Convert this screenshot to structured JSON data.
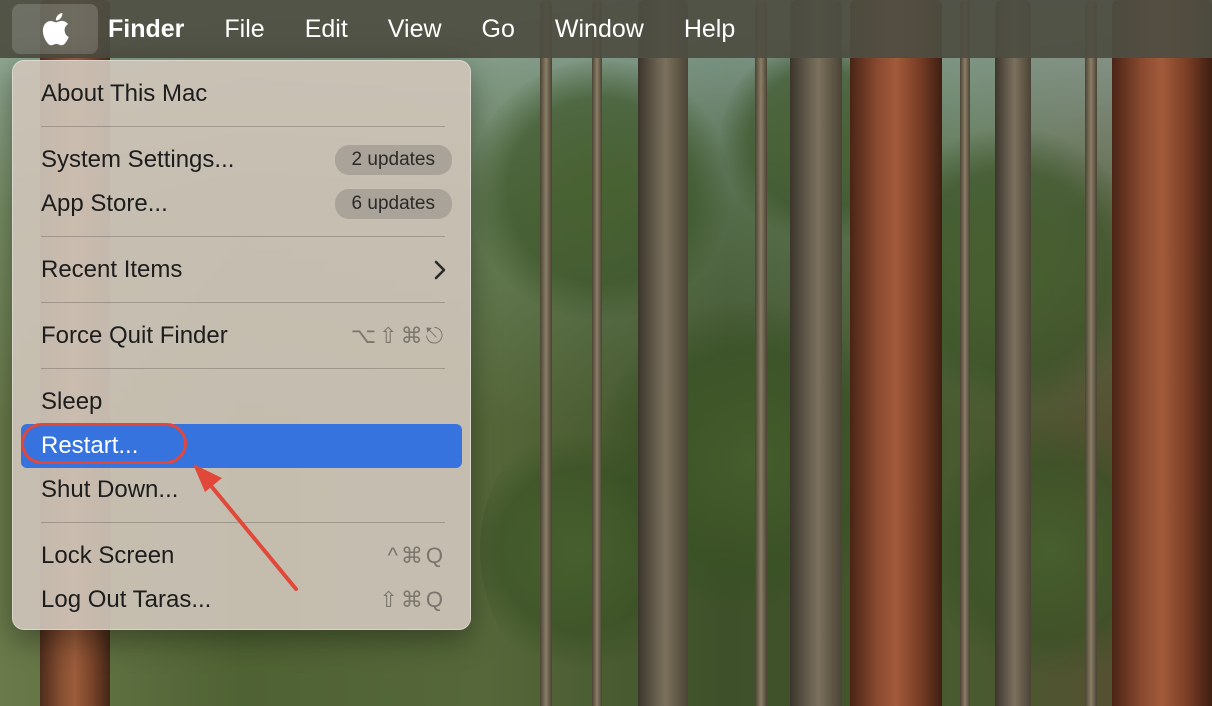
{
  "menubar": {
    "apple_icon": "apple-logo-icon",
    "items": [
      {
        "label": "Finder"
      },
      {
        "label": "File"
      },
      {
        "label": "Edit"
      },
      {
        "label": "View"
      },
      {
        "label": "Go"
      },
      {
        "label": "Window"
      },
      {
        "label": "Help"
      }
    ]
  },
  "apple_menu": {
    "about": {
      "label": "About This Mac"
    },
    "system_settings": {
      "label": "System Settings...",
      "badge": "2 updates"
    },
    "app_store": {
      "label": "App Store...",
      "badge": "6 updates"
    },
    "recent_items": {
      "label": "Recent Items",
      "submenu_icon": "chevron-right-icon"
    },
    "force_quit": {
      "label": "Force Quit Finder",
      "shortcut": "⌥⇧⌘⎋"
    },
    "sleep": {
      "label": "Sleep"
    },
    "restart": {
      "label": "Restart..."
    },
    "shut_down": {
      "label": "Shut Down..."
    },
    "lock_screen": {
      "label": "Lock Screen",
      "shortcut": "^⌘Q"
    },
    "log_out": {
      "label": "Log Out Taras...",
      "shortcut": "⇧⌘Q"
    }
  },
  "colors": {
    "highlight": "#3673de",
    "annotation": "#e2483a"
  }
}
